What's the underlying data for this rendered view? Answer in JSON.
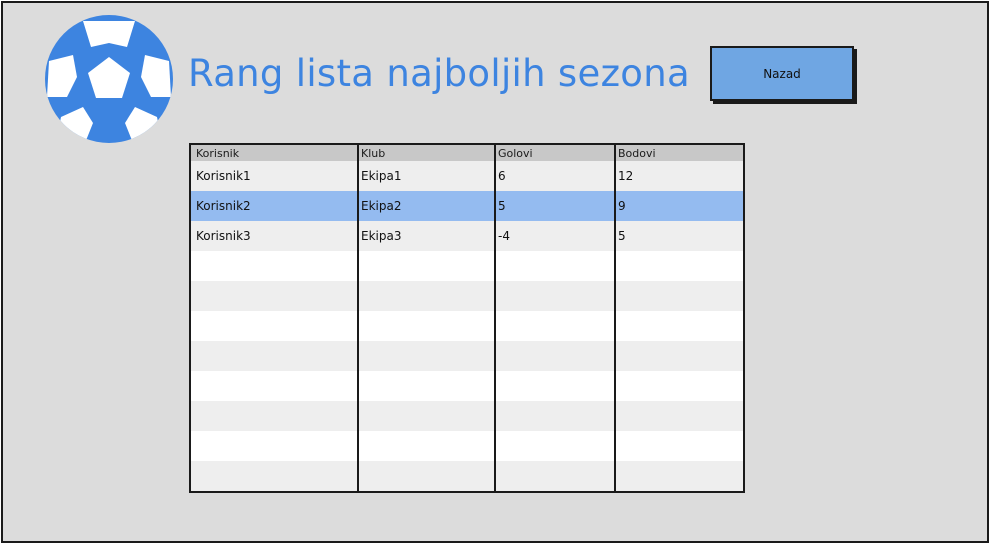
{
  "window": {
    "title": "Rang lista najboljih sezona",
    "back_button_label": "Nazad"
  },
  "colors": {
    "accent": "#3d84e0",
    "button": "#6fa6e3",
    "selected_row": "#94bbf0",
    "background": "#dcdcdc"
  },
  "icons": {
    "logo": "soccer-ball-icon"
  },
  "table": {
    "columns": [
      "Korisnik",
      "Klub",
      "Golovi",
      "Bodovi"
    ],
    "rows": [
      [
        "Korisnik1",
        "Ekipa1",
        "6",
        "12"
      ],
      [
        "Korisnik2",
        "Ekipa2",
        "5",
        "9"
      ],
      [
        "Korisnik3",
        "Ekipa3",
        "-4",
        "5"
      ]
    ],
    "selected_row_index": 1
  }
}
